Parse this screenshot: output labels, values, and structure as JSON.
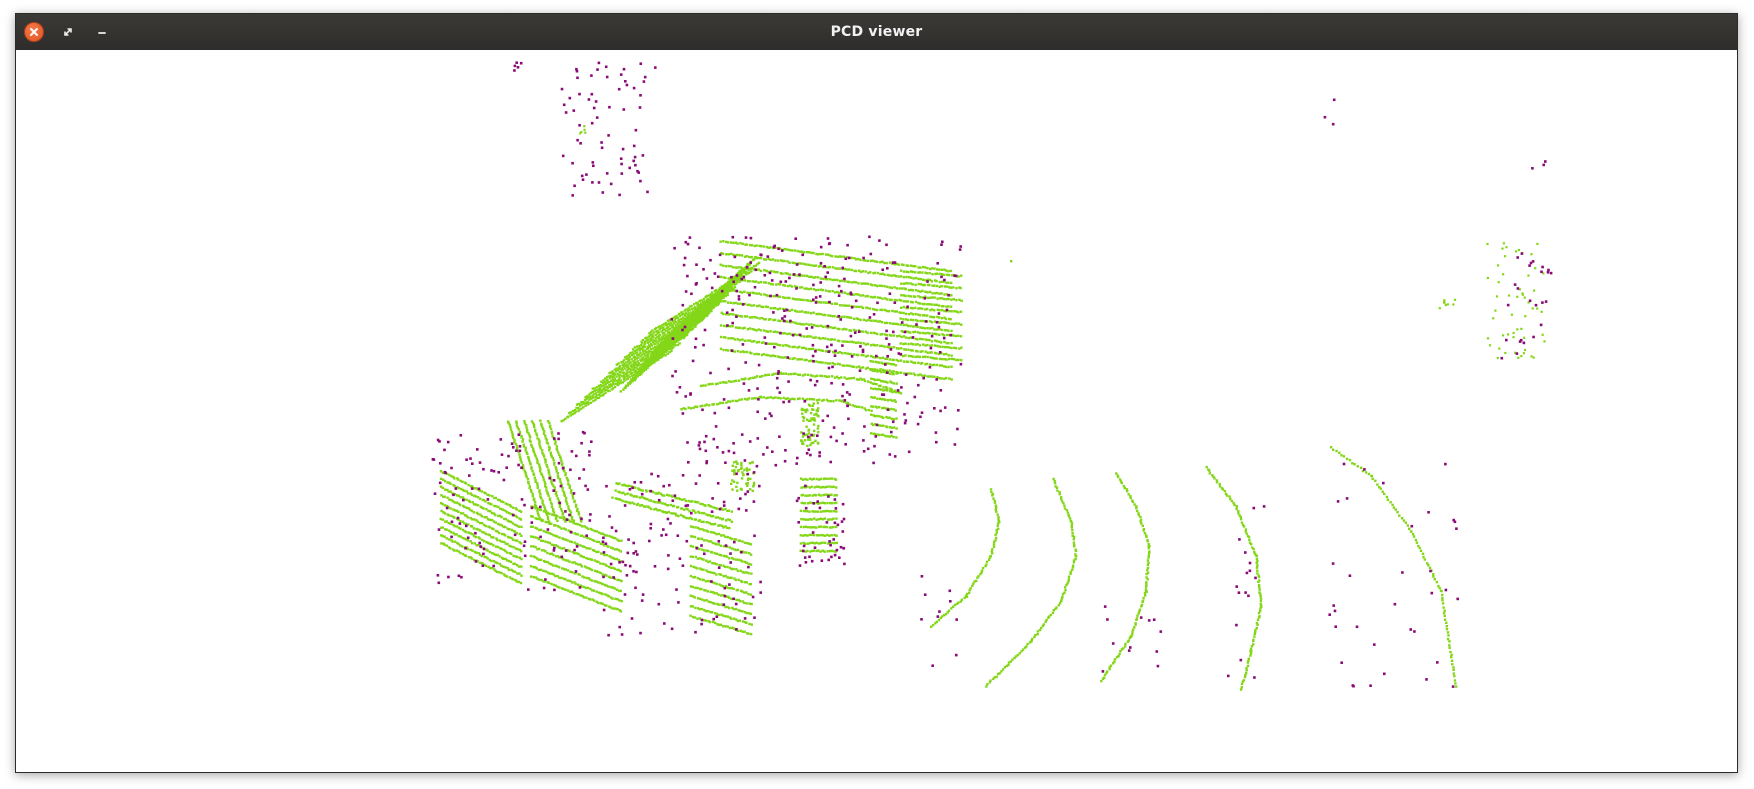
{
  "window": {
    "title": "PCD viewer"
  },
  "controls": [
    {
      "name": "close-button",
      "icon": "close-icon"
    },
    {
      "name": "maximize-button",
      "icon": "maximize-icon"
    },
    {
      "name": "minimize-button",
      "icon": "minimize-icon"
    }
  ],
  "colors": {
    "titlebar": "#2e2d2b",
    "close_button": "#e05420",
    "ground_points": "#84d718",
    "obstacle_points": "#8a0a78",
    "background": "#ffffff"
  }
}
